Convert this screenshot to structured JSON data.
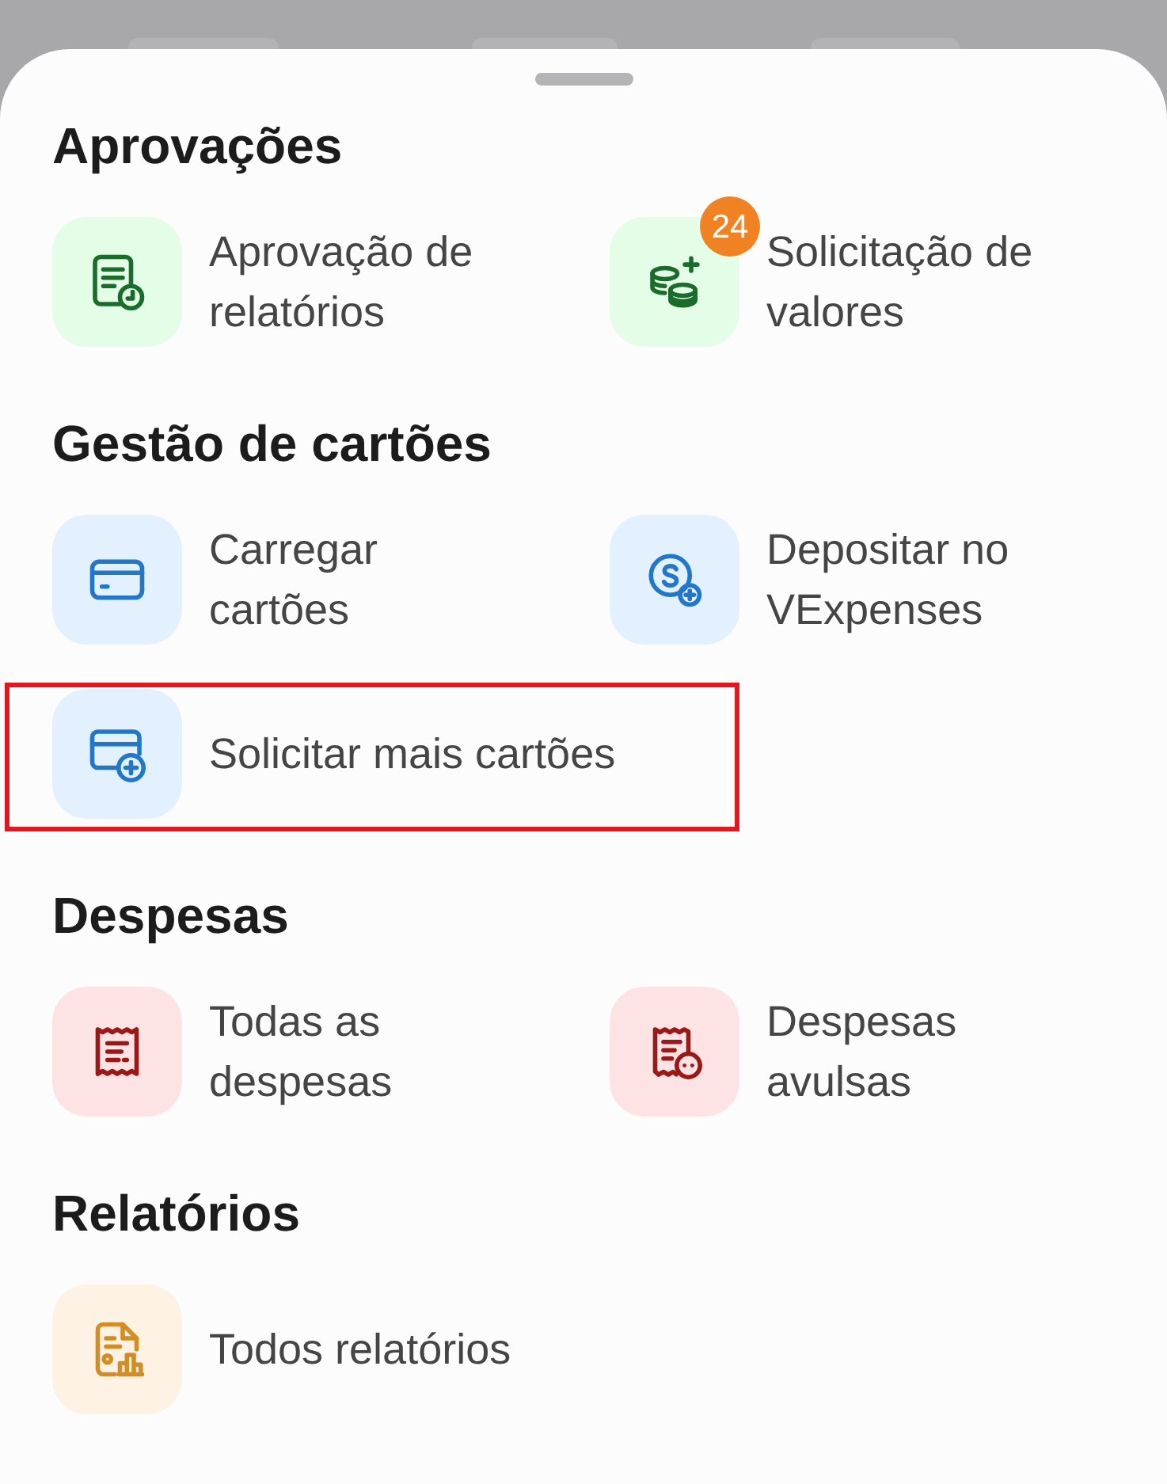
{
  "sheet": {
    "sections": [
      {
        "title": "Aprovações",
        "color": "#1b6b2a",
        "items": [
          {
            "kind": "report-clock",
            "label": "Aprovação de\nrelatórios",
            "highlighted": false
          },
          {
            "kind": "coins-plus",
            "label": "Solicitação de\nvalores",
            "badge": "24",
            "highlighted": false
          }
        ]
      },
      {
        "title": "Gestão de cartões",
        "color": "#2277c9",
        "items": [
          {
            "kind": "card",
            "label": "Carregar\ncartões",
            "highlighted": false
          },
          {
            "kind": "coin-plus",
            "label": "Depositar no\nVExpenses",
            "highlighted": false
          },
          {
            "kind": "card-plus",
            "label": "Solicitar mais cartões",
            "highlighted": true
          }
        ]
      },
      {
        "title": "Despesas",
        "color": "#9a1818",
        "items": [
          {
            "kind": "receipt",
            "label": "Todas as\ndespesas",
            "highlighted": false
          },
          {
            "kind": "receipt-dots",
            "label": "Despesas\navulsas",
            "highlighted": false
          }
        ]
      },
      {
        "title": "Relatórios",
        "color": "#d28d25",
        "items": [
          {
            "kind": "document-chart",
            "label": "Todos relatórios",
            "highlighted": false
          }
        ]
      }
    ]
  }
}
